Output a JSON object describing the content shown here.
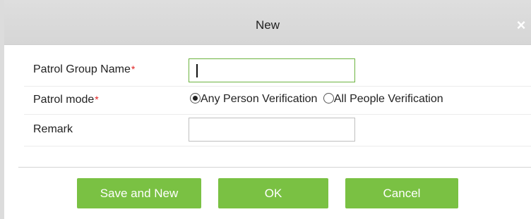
{
  "dialog": {
    "title": "New",
    "close_symbol": "×"
  },
  "form": {
    "group_name": {
      "label": "Patrol Group Name",
      "required_mark": "*",
      "value": ""
    },
    "patrol_mode": {
      "label": "Patrol mode",
      "required_mark": "*",
      "options": [
        {
          "label": "Any Person Verification",
          "checked": true
        },
        {
          "label": "All People Verification",
          "checked": false
        }
      ]
    },
    "remark": {
      "label": "Remark",
      "value": ""
    }
  },
  "buttons": {
    "save_and_new": "Save and New",
    "ok": "OK",
    "cancel": "Cancel"
  },
  "colors": {
    "button_green": "#7ac143",
    "required_red": "#e02020",
    "titlebar_gray": "#d9d9d9"
  },
  "icons": {
    "close": "close-icon",
    "radio_checked": "radio-checked-icon",
    "radio_unchecked": "radio-unchecked-icon"
  }
}
